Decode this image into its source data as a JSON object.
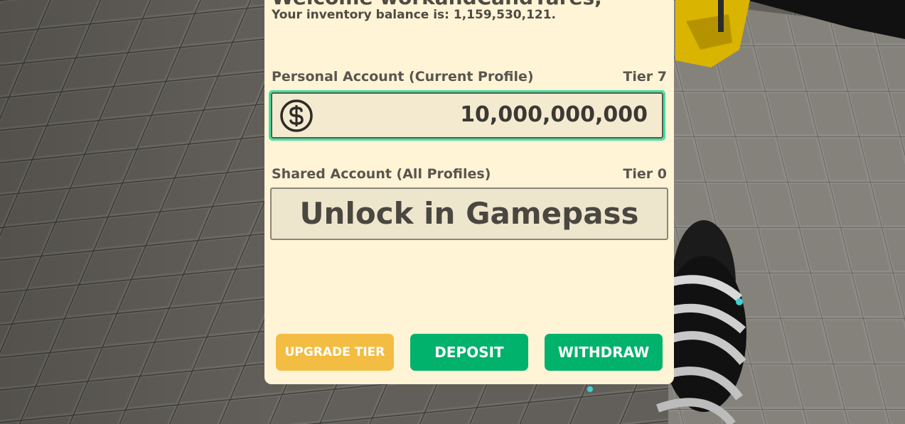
{
  "bank": {
    "welcome_text": "Welcome workandCandYares,",
    "inventory_text": "Your inventory balance is: 1,159,530,121.",
    "personal": {
      "label": "Personal Account (Current Profile)",
      "tier": "Tier 7",
      "amount": "10,000,000,000",
      "icon": "dollar-coin-icon",
      "highlight_color": "#3fe3a0"
    },
    "shared": {
      "label": "Shared Account (All Profiles)",
      "tier": "Tier 0",
      "locked_text": "Unlock in Gamepass"
    },
    "buttons": {
      "upgrade_label": "UPGRADE TIER",
      "deposit_label": "DEPOSIT",
      "withdraw_label": "WITHDRAW"
    },
    "colors": {
      "panel_bg": "#fff4d6",
      "upgrade_bg": "#f3bd43",
      "action_bg": "#00b26b"
    }
  }
}
